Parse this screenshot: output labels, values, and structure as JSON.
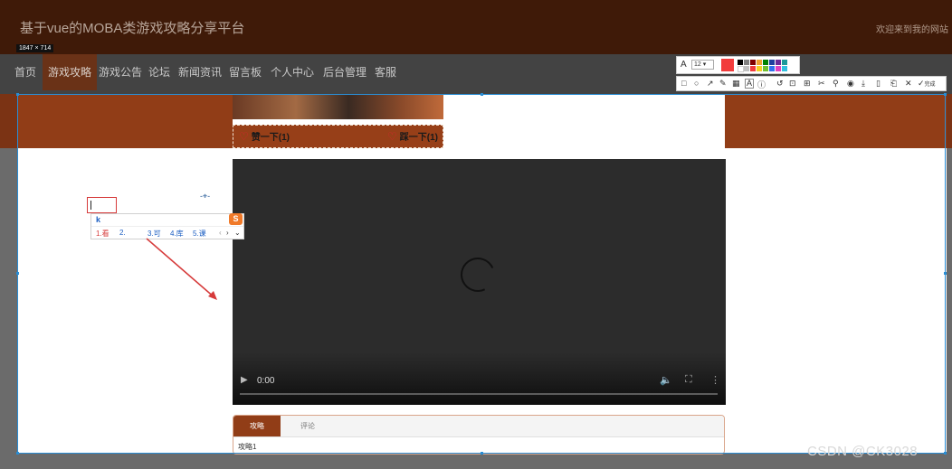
{
  "header": {
    "site_title": "基于vue的MOBA类游戏攻略分享平台",
    "welcome_text": "欢迎来到我的网站"
  },
  "screenshot_tool": {
    "size_label": "1847 × 714",
    "font_size_value": "12",
    "confirm_label": "完成",
    "palette": [
      "#000000",
      "#808080",
      "#800000",
      "#808000",
      "#008000",
      "#008080",
      "#000080",
      "#800080",
      "#008080",
      "#ffffff",
      "#c0c0c0",
      "#ff0000",
      "#ffff00",
      "#00ff00",
      "#00ffff",
      "#0000ff",
      "#ff00ff",
      "#00ffff"
    ],
    "current_color": "#f23c3c",
    "tool_icons": [
      "rect-icon",
      "ellipse-icon",
      "arrow-icon",
      "pen-icon",
      "mosaic-icon",
      "text-icon",
      "marker-icon",
      "undo-icon",
      "ocr-icon",
      "translate-icon",
      "pin-icon",
      "eyedropper-icon",
      "record-icon",
      "save-icon",
      "phone-icon",
      "bookmark-icon",
      "close-icon",
      "check-icon"
    ]
  },
  "nav": {
    "items": [
      {
        "label": "首页",
        "active": false
      },
      {
        "label": "游戏攻略",
        "active": true
      },
      {
        "label": "游戏公告",
        "active": false
      },
      {
        "label": "论坛",
        "active": false
      },
      {
        "label": "新闻资讯",
        "active": false
      },
      {
        "label": "留言板",
        "active": false
      },
      {
        "label": "个人中心",
        "active": false
      },
      {
        "label": "后台管理",
        "active": false
      },
      {
        "label": "客服",
        "active": false
      }
    ]
  },
  "vote": {
    "like_label": "赞一下(1)",
    "dislike_label": "踩一下(1)"
  },
  "video": {
    "time": "0:00",
    "progress": 0
  },
  "tabs": {
    "items": [
      "攻略",
      "评论"
    ],
    "active_index": 0,
    "content": "攻略1"
  },
  "ime": {
    "input": "k",
    "candidates": [
      "1.看",
      "2.",
      "3.可",
      "4.库",
      "5.课"
    ]
  },
  "watermark": "CSDN @CK3028",
  "colors": {
    "header_bg": "#3f1a08",
    "brand_orange": "#913d17",
    "nav_active": "#6a3217",
    "selection_blue": "#2a8dd4",
    "annotation_red": "#d63a3a"
  }
}
